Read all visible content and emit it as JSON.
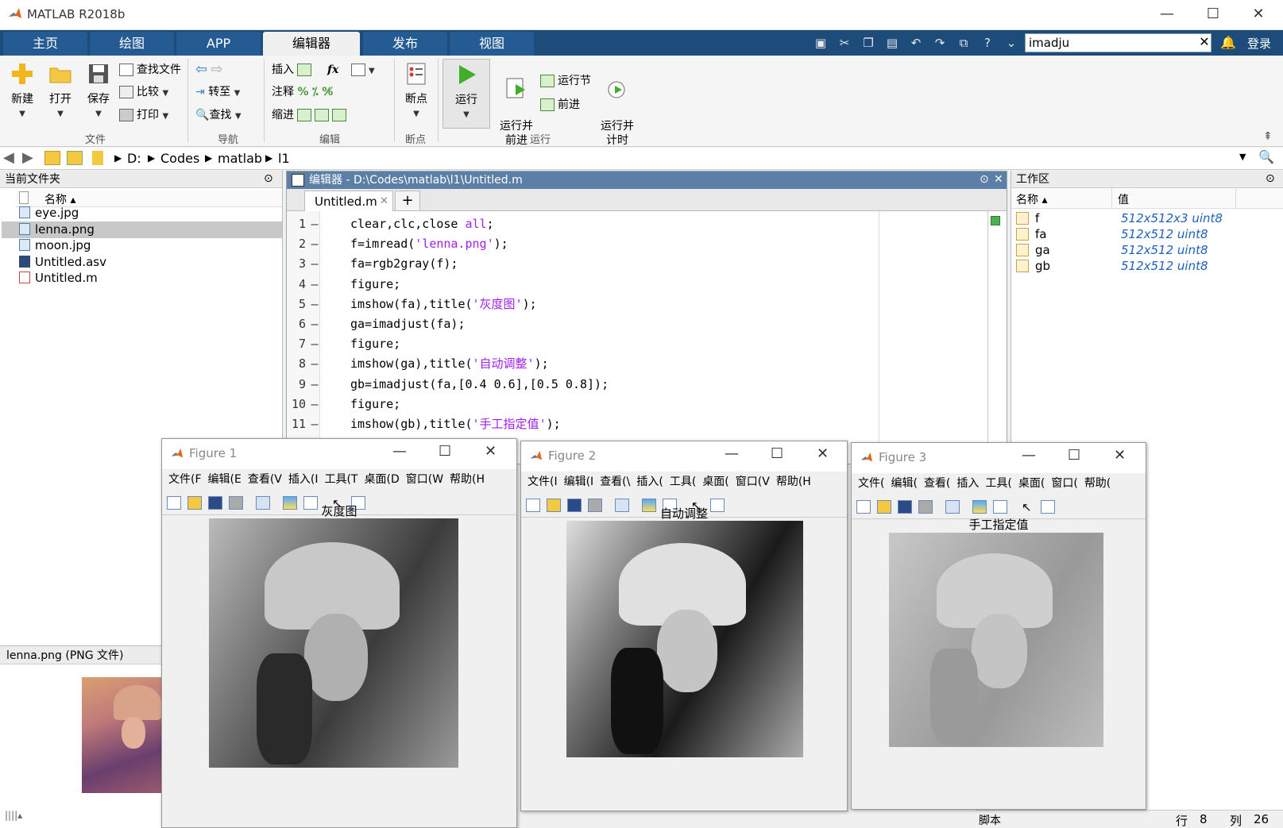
{
  "window": {
    "title": "MATLAB R2018b",
    "min": "—",
    "max": "☐",
    "close": "✕"
  },
  "tabs": [
    "主页",
    "绘图",
    "APP",
    "编辑器",
    "发布",
    "视图"
  ],
  "search": {
    "value": "imadju",
    "clear": "✕",
    "login": "登录"
  },
  "toolstrip": {
    "file": {
      "label": "文件",
      "new": "新建",
      "open": "打开",
      "save": "保存",
      "find_files": "查找文件",
      "compare": "比较",
      "print": "打印"
    },
    "nav": {
      "label": "导航",
      "goto": "转至",
      "find": "查找"
    },
    "edit": {
      "label": "编辑",
      "insert": "插入",
      "comment": "注释",
      "indent": "缩进",
      "fx": "fx"
    },
    "breakpoints": {
      "label": "断点",
      "btn": "断点"
    },
    "run": {
      "label": "运行",
      "run": "运行",
      "run_advance": "运行并\n前进",
      "run_section": "运行节",
      "advance": "前进",
      "run_time": "运行并\n计时"
    }
  },
  "address": {
    "crumbs": [
      "D:",
      "Codes",
      "matlab",
      "l1"
    ]
  },
  "current_folder": {
    "title": "当前文件夹",
    "col_name": "名称 ▴",
    "files": [
      "eye.jpg",
      "lenna.png",
      "moon.jpg",
      "Untitled.asv",
      "Untitled.m"
    ],
    "selected_index": 1,
    "detail_title": "lenna.png  (PNG 文件)"
  },
  "editor": {
    "title": "编辑器 - D:\\Codes\\matlab\\l1\\Untitled.m",
    "tab": "Untitled.m",
    "tab_close": "✕",
    "add_tab": "+",
    "lines": [
      {
        "n": "1",
        "code": "clear,clc,close ",
        "str": "all",
        "end": ";"
      },
      {
        "n": "2",
        "code": "f=imread(",
        "str": "'lenna.png'",
        "end": ");"
      },
      {
        "n": "3",
        "code": "fa=rgb2gray(f);",
        "str": "",
        "end": ""
      },
      {
        "n": "4",
        "code": "figure;",
        "str": "",
        "end": ""
      },
      {
        "n": "5",
        "code": "imshow(fa),title(",
        "str": "'灰度图'",
        "end": ");"
      },
      {
        "n": "6",
        "code": "ga=imadjust(fa);",
        "str": "",
        "end": ""
      },
      {
        "n": "7",
        "code": "figure;",
        "str": "",
        "end": ""
      },
      {
        "n": "8",
        "code": "imshow(ga),title(",
        "str": "'自动调整'",
        "end": ");"
      },
      {
        "n": "9",
        "code": "gb=imadjust(fa,[0.4 0.6],[0.5 0.8]);",
        "str": "",
        "end": ""
      },
      {
        "n": "10",
        "code": "figure;",
        "str": "",
        "end": ""
      },
      {
        "n": "11",
        "code": "imshow(gb),title(",
        "str": "'手工指定值'",
        "end": ");"
      }
    ]
  },
  "workspace": {
    "title": "工作区",
    "col_name": "名称 ▴",
    "col_value": "值",
    "vars": [
      {
        "name": "f",
        "value": "512x512x3 uint8"
      },
      {
        "name": "fa",
        "value": "512x512 uint8"
      },
      {
        "name": "ga",
        "value": "512x512 uint8"
      },
      {
        "name": "gb",
        "value": "512x512 uint8"
      }
    ]
  },
  "figures": [
    {
      "title": "Figure 1",
      "menu": [
        "文件(F",
        "编辑(E",
        "查看(V",
        "插入(I",
        "工具(T",
        "桌面(D",
        "窗口(W",
        "帮助(H"
      ],
      "caption": "灰度图"
    },
    {
      "title": "Figure 2",
      "menu": [
        "文件(I",
        "编辑(I",
        "查看(\\",
        "插入(",
        "工具(",
        "桌面(",
        "窗口(V",
        "帮助(H"
      ],
      "caption": "自动调整"
    },
    {
      "title": "Figure 3",
      "menu": [
        "文件(",
        "编辑(",
        "查看(",
        "插入",
        "工具(",
        "桌面(",
        "窗口(",
        "帮助("
      ],
      "caption": "手工指定值"
    }
  ],
  "status": {
    "mode": "脚本",
    "row_label": "行",
    "row": "8",
    "col_label": "列",
    "col": "26"
  }
}
